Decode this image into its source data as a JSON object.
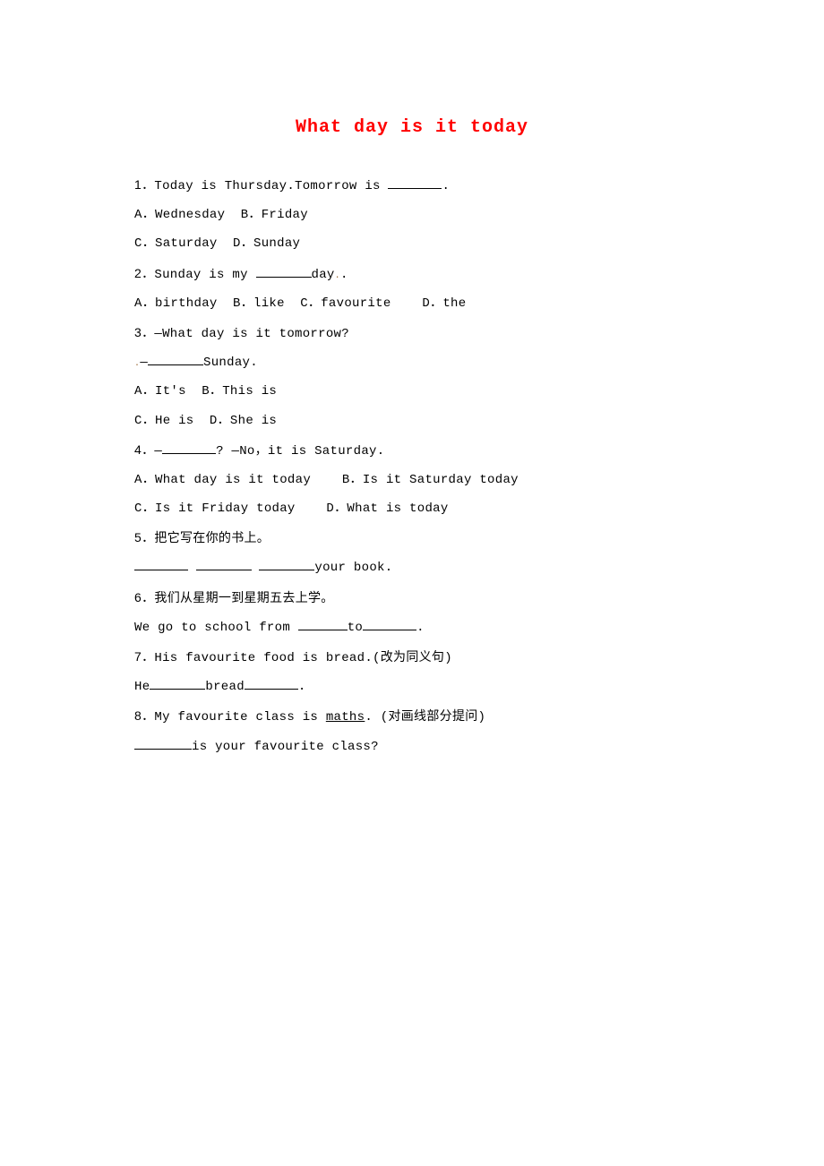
{
  "title": "What day is it today",
  "questions": {
    "q1": {
      "num": "1．",
      "text_before": "Today is Thursday.Tomorrow is ",
      "text_after": ".",
      "options_line1": "A．Wednesday  B．Friday",
      "options_line2": "C．Saturday  D．Sunday"
    },
    "q2": {
      "num": "2．",
      "text_before": "Sunday is my ",
      "text_after": "day",
      "options": "A．birthday  B．like  C．favourite    D．the"
    },
    "q3": {
      "num": "3．",
      "text": "—What day is it tomorrow?",
      "dash": "—",
      "text_after": "Sunday.",
      "options_line1": "A．It's  B．This is",
      "options_line2": "C．He is  D．She is"
    },
    "q4": {
      "num": "4．",
      "dash_before": "—",
      "q_mark": "? —No，it is Saturday.",
      "options_line1": "A．What day is it today    B．Is it Saturday today",
      "options_line2": "C．Is it Friday today    D．What is today"
    },
    "q5": {
      "num": "5．",
      "text": "把它写在你的书上。",
      "answer_after": "your book."
    },
    "q6": {
      "num": "6．",
      "text": "我们从星期一到星期五去上学。",
      "answer_before": "We go to school from ",
      "answer_mid": "to",
      "answer_after": "."
    },
    "q7": {
      "num": "7．",
      "text": "His favourite food is bread.(改为同义句)",
      "answer_before": "He",
      "answer_mid": "bread",
      "answer_after": "."
    },
    "q8": {
      "num": "8．",
      "text_before": "My favourite class is ",
      "underlined": "maths",
      "text_after": ". (对画线部分提问)",
      "answer_after": "is your favourite class?"
    }
  }
}
